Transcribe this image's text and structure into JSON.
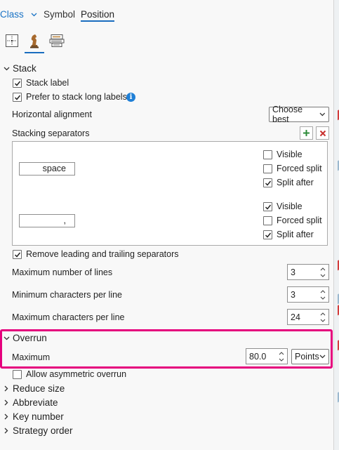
{
  "tabs": {
    "class_label": "Class",
    "symbol_label": "Symbol",
    "position_label": "Position"
  },
  "icon_tabs": [
    "placement-icon",
    "conflict-resolution-icon",
    "fitting-strategy-icon"
  ],
  "stack": {
    "heading": "Stack",
    "stack_label": {
      "label": "Stack label",
      "checked": true
    },
    "prefer_long": {
      "label": "Prefer to stack long labels",
      "checked": true
    },
    "horizontal_alignment": {
      "label": "Horizontal alignment",
      "value": "Choose best"
    },
    "separators_label": "Stacking separators",
    "separators": [
      {
        "text": "space",
        "visible": "Visible",
        "forced": "Forced split",
        "after": "Split after",
        "visible_checked": false,
        "forced_checked": false,
        "after_checked": true
      },
      {
        "text": ",",
        "visible": "Visible",
        "forced": "Forced split",
        "after": "Split after",
        "visible_checked": true,
        "forced_checked": false,
        "after_checked": true
      }
    ],
    "remove_separators": {
      "label": "Remove leading and trailing separators",
      "checked": true
    },
    "max_lines": {
      "label": "Maximum number of lines",
      "value": "3"
    },
    "min_chars": {
      "label": "Minimum characters per line",
      "value": "3"
    },
    "max_chars": {
      "label": "Maximum characters per line",
      "value": "24"
    }
  },
  "overrun": {
    "heading": "Overrun",
    "maximum_label": "Maximum",
    "maximum_value": "80.0",
    "unit": "Points",
    "asymmetric": {
      "label": "Allow asymmetric overrun",
      "checked": false
    }
  },
  "collapsed_sections": [
    "Reduce size",
    "Abbreviate",
    "Key number",
    "Strategy order"
  ],
  "colors": {
    "accent": "#1a6dbf",
    "highlight": "#e5007d",
    "add": "#2e8b3a",
    "remove": "#c8302e"
  }
}
